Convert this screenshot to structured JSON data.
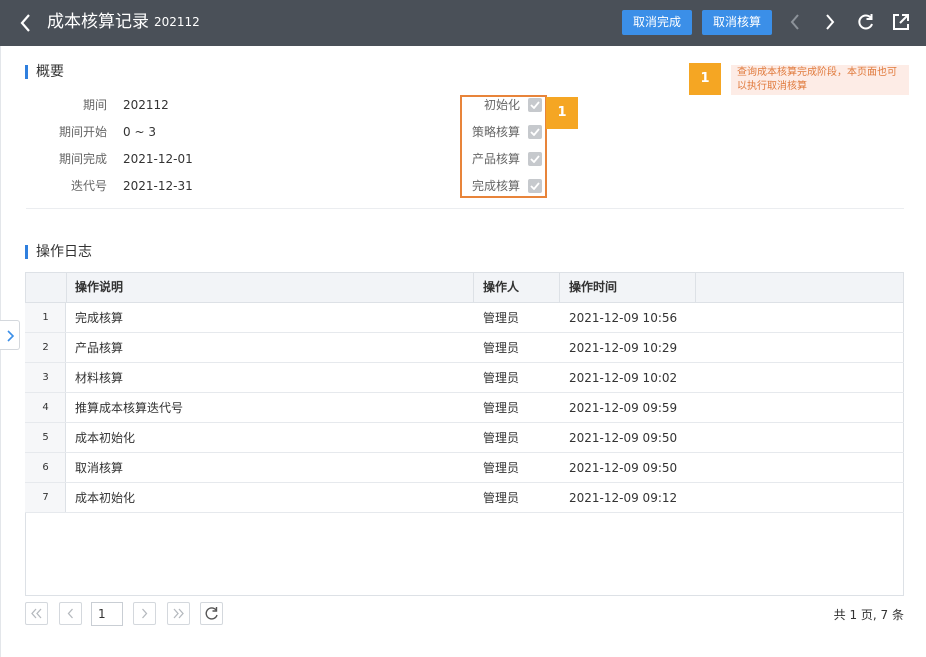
{
  "header": {
    "title": "成本核算记录",
    "period": "202112",
    "cancel_complete_label": "取消完成",
    "cancel_calc_label": "取消核算",
    "icons": [
      "back-icon",
      "prev-icon",
      "next-icon",
      "refresh-icon",
      "open-external-icon"
    ]
  },
  "overview": {
    "title": "概要",
    "fields": [
      {
        "label": "期间",
        "value": "202112"
      },
      {
        "label": "期间开始",
        "value": "0 ~ 3"
      },
      {
        "label": "期间完成",
        "value": "2021-12-01"
      },
      {
        "label": "迭代号",
        "value": "2021-12-31"
      }
    ],
    "stages": [
      {
        "label": "初始化",
        "checked": true
      },
      {
        "label": "策略核算",
        "checked": true
      },
      {
        "label": "产品核算",
        "checked": true
      },
      {
        "label": "完成核算",
        "checked": true
      }
    ]
  },
  "annotation": {
    "badge": "1",
    "note": "查询成本核算完成阶段，本页面也可以执行取消核算"
  },
  "log": {
    "title": "操作日志",
    "columns": [
      "操作说明",
      "操作人",
      "操作时间"
    ],
    "rows": [
      {
        "idx": "1",
        "desc": "完成核算",
        "user": "管理员",
        "time": "2021-12-09 10:56"
      },
      {
        "idx": "2",
        "desc": "产品核算",
        "user": "管理员",
        "time": "2021-12-09 10:29"
      },
      {
        "idx": "3",
        "desc": "材料核算",
        "user": "管理员",
        "time": "2021-12-09 10:02"
      },
      {
        "idx": "4",
        "desc": "推算成本核算迭代号",
        "user": "管理员",
        "time": "2021-12-09 09:59"
      },
      {
        "idx": "5",
        "desc": "成本初始化",
        "user": "管理员",
        "time": "2021-12-09 09:50"
      },
      {
        "idx": "6",
        "desc": "取消核算",
        "user": "管理员",
        "time": "2021-12-09 09:50"
      },
      {
        "idx": "7",
        "desc": "成本初始化",
        "user": "管理员",
        "time": "2021-12-09 09:12"
      }
    ]
  },
  "pagination": {
    "current_page": "1",
    "summary": "共 1 页, 7 条"
  },
  "colors": {
    "header_bg": "#4a5058",
    "button": "#3b8fe8",
    "accent": "#2f7fde",
    "highlight": "#e8843a",
    "badge": "#f5a623"
  }
}
